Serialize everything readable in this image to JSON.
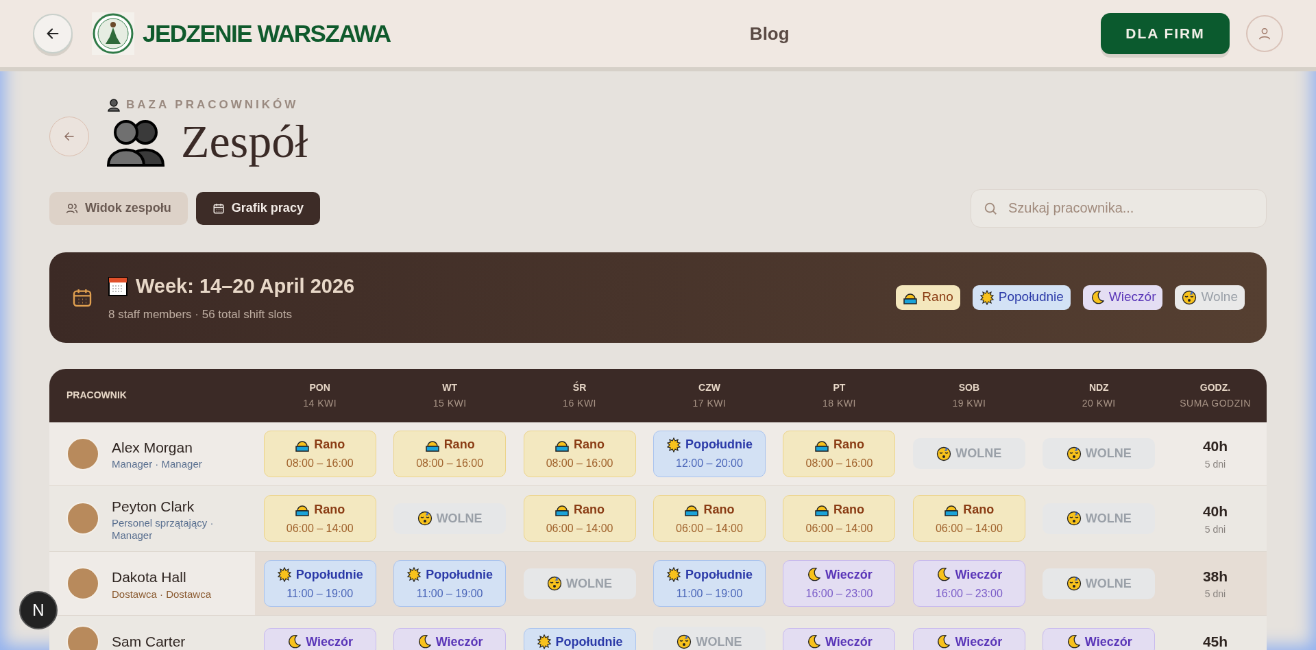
{
  "header": {
    "brand": "JEDZENIE WARSZAWA",
    "nav_link": "Blog",
    "cta": "DLA FIRM"
  },
  "page": {
    "eyebrow": "BAZA PRACOWNIKÓW",
    "title": "Zespół"
  },
  "tabs": [
    {
      "label": "Widok zespołu",
      "kind": "users",
      "selected": false
    },
    {
      "label": "Grafik pracy",
      "kind": "calendar",
      "selected": true
    }
  ],
  "search": {
    "placeholder": "Szukaj pracownika..."
  },
  "week_banner": {
    "title": "Week: 14–20 April 2026",
    "subtitle": "8 staff members · 56 total shift slots",
    "legend": [
      {
        "kind": "rano",
        "label": "Rano"
      },
      {
        "kind": "popoludnie",
        "label": "Popołudnie"
      },
      {
        "kind": "wieczor",
        "label": "Wieczór"
      },
      {
        "kind": "wolne",
        "label": "Wolne"
      }
    ]
  },
  "table": {
    "first_column": "PRACOWNIK",
    "days": [
      {
        "day": "PON",
        "date": "14 KWI"
      },
      {
        "day": "WT",
        "date": "15 KWI"
      },
      {
        "day": "ŚR",
        "date": "16 KWI"
      },
      {
        "day": "CZW",
        "date": "17 KWI"
      },
      {
        "day": "PT",
        "date": "18 KWI"
      },
      {
        "day": "SOB",
        "date": "19 KWI"
      },
      {
        "day": "NDZ",
        "date": "20 KWI"
      }
    ],
    "total_column": {
      "title": "GODZ.",
      "subtitle": "SUMA GODZIN"
    },
    "rows": [
      {
        "name": "Alex Morgan",
        "role": "Manager · Manager",
        "highlighted": false,
        "total": "40h",
        "days": "5 dni",
        "shifts": [
          {
            "kind": "rano",
            "label": "Rano",
            "time": "08:00 – 16:00"
          },
          {
            "kind": "rano",
            "label": "Rano",
            "time": "08:00 – 16:00"
          },
          {
            "kind": "rano",
            "label": "Rano",
            "time": "08:00 – 16:00"
          },
          {
            "kind": "popoludnie",
            "label": "Popołudnie",
            "time": "12:00 – 20:00"
          },
          {
            "kind": "rano",
            "label": "Rano",
            "time": "08:00 – 16:00"
          },
          {
            "kind": "wolne",
            "label": "WOLNE"
          },
          {
            "kind": "wolne",
            "label": "WOLNE"
          }
        ]
      },
      {
        "name": "Peyton Clark",
        "role": "Personel sprzątający · Manager",
        "highlighted": false,
        "total": "40h",
        "days": "5 dni",
        "shifts": [
          {
            "kind": "rano",
            "label": "Rano",
            "time": "06:00 – 14:00"
          },
          {
            "kind": "wolne",
            "label": "WOLNE"
          },
          {
            "kind": "rano",
            "label": "Rano",
            "time": "06:00 – 14:00"
          },
          {
            "kind": "rano",
            "label": "Rano",
            "time": "06:00 – 14:00"
          },
          {
            "kind": "rano",
            "label": "Rano",
            "time": "06:00 – 14:00"
          },
          {
            "kind": "rano",
            "label": "Rano",
            "time": "06:00 – 14:00"
          },
          {
            "kind": "wolne",
            "label": "WOLNE"
          }
        ]
      },
      {
        "name": "Dakota Hall",
        "role": "Dostawca · Dostawca",
        "highlighted": true,
        "total": "38h",
        "days": "5 dni",
        "shifts": [
          {
            "kind": "popoludnie",
            "label": "Popołudnie",
            "time": "11:00 – 19:00"
          },
          {
            "kind": "popoludnie",
            "label": "Popołudnie",
            "time": "11:00 – 19:00"
          },
          {
            "kind": "wolne",
            "label": "WOLNE"
          },
          {
            "kind": "popoludnie",
            "label": "Popołudnie",
            "time": "11:00 – 19:00"
          },
          {
            "kind": "wieczor",
            "label": "Wieczór",
            "time": "16:00 – 23:00"
          },
          {
            "kind": "wieczor",
            "label": "Wieczór",
            "time": "16:00 – 23:00"
          },
          {
            "kind": "wolne",
            "label": "WOLNE"
          }
        ]
      },
      {
        "name": "Sam Carter",
        "highlighted": false,
        "total": "45h",
        "shifts": [
          {
            "kind": "wieczor",
            "label": "Wieczór"
          },
          {
            "kind": "wieczor",
            "label": "Wieczór"
          },
          {
            "kind": "popoludnie",
            "label": "Popołudnie"
          },
          {
            "kind": "wolne",
            "label": "WOLNE"
          },
          {
            "kind": "wieczor",
            "label": "Wieczór"
          },
          {
            "kind": "wieczor",
            "label": "Wieczór"
          },
          {
            "kind": "wieczor",
            "label": "Wieczór"
          }
        ]
      }
    ]
  },
  "dev_badge": "N"
}
